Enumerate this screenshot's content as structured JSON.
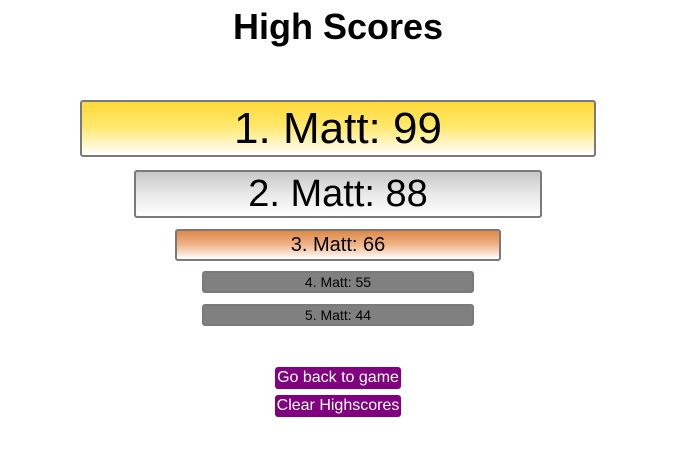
{
  "title": "High Scores",
  "scores": [
    {
      "label": "1. Matt: 99",
      "rank": 1,
      "name": "Matt",
      "score": 99,
      "color": "#ffd93a"
    },
    {
      "label": "2. Matt: 88",
      "rank": 2,
      "name": "Matt",
      "score": 88,
      "color": "#c8c8c8"
    },
    {
      "label": "3. Matt: 66",
      "rank": 3,
      "name": "Matt",
      "score": 66,
      "color": "#de8a46"
    },
    {
      "label": "4. Matt: 55",
      "rank": 4,
      "name": "Matt",
      "score": 55,
      "color": "#808080"
    },
    {
      "label": "5. Matt: 44",
      "rank": 5,
      "name": "Matt",
      "score": 44,
      "color": "#808080"
    }
  ],
  "buttons": {
    "back_label": "Go back to game",
    "clear_label": "Clear Highscores",
    "color": "#800080"
  }
}
